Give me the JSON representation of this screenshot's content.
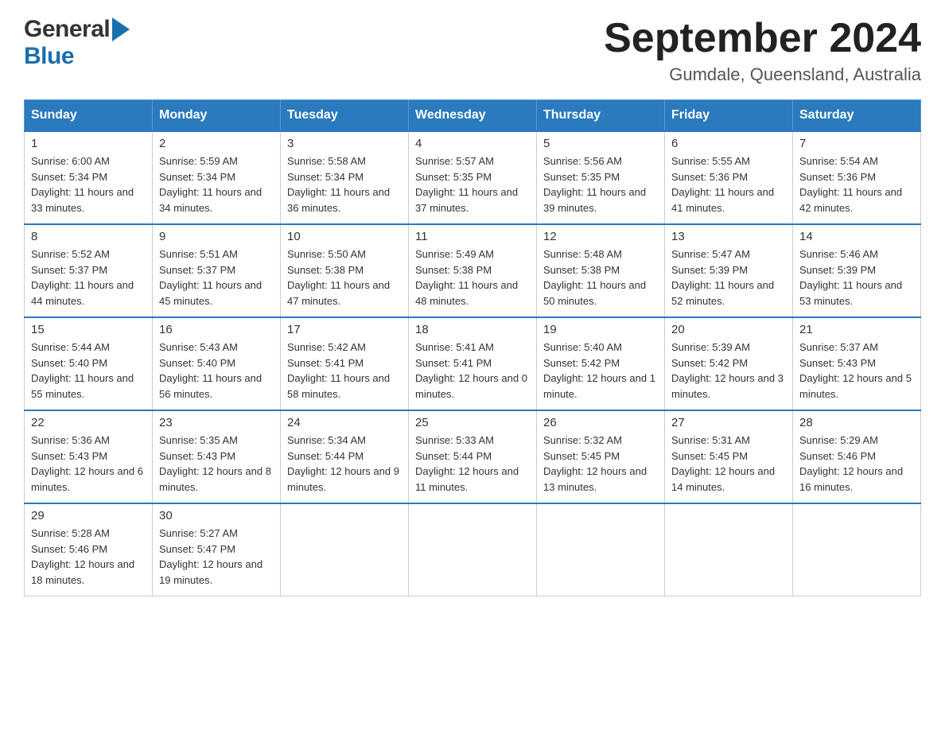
{
  "logo": {
    "general": "General",
    "blue": "Blue"
  },
  "title": "September 2024",
  "location": "Gumdale, Queensland, Australia",
  "headers": [
    "Sunday",
    "Monday",
    "Tuesday",
    "Wednesday",
    "Thursday",
    "Friday",
    "Saturday"
  ],
  "weeks": [
    [
      {
        "day": "1",
        "sunrise": "6:00 AM",
        "sunset": "5:34 PM",
        "daylight": "11 hours and 33 minutes."
      },
      {
        "day": "2",
        "sunrise": "5:59 AM",
        "sunset": "5:34 PM",
        "daylight": "11 hours and 34 minutes."
      },
      {
        "day": "3",
        "sunrise": "5:58 AM",
        "sunset": "5:34 PM",
        "daylight": "11 hours and 36 minutes."
      },
      {
        "day": "4",
        "sunrise": "5:57 AM",
        "sunset": "5:35 PM",
        "daylight": "11 hours and 37 minutes."
      },
      {
        "day": "5",
        "sunrise": "5:56 AM",
        "sunset": "5:35 PM",
        "daylight": "11 hours and 39 minutes."
      },
      {
        "day": "6",
        "sunrise": "5:55 AM",
        "sunset": "5:36 PM",
        "daylight": "11 hours and 41 minutes."
      },
      {
        "day": "7",
        "sunrise": "5:54 AM",
        "sunset": "5:36 PM",
        "daylight": "11 hours and 42 minutes."
      }
    ],
    [
      {
        "day": "8",
        "sunrise": "5:52 AM",
        "sunset": "5:37 PM",
        "daylight": "11 hours and 44 minutes."
      },
      {
        "day": "9",
        "sunrise": "5:51 AM",
        "sunset": "5:37 PM",
        "daylight": "11 hours and 45 minutes."
      },
      {
        "day": "10",
        "sunrise": "5:50 AM",
        "sunset": "5:38 PM",
        "daylight": "11 hours and 47 minutes."
      },
      {
        "day": "11",
        "sunrise": "5:49 AM",
        "sunset": "5:38 PM",
        "daylight": "11 hours and 48 minutes."
      },
      {
        "day": "12",
        "sunrise": "5:48 AM",
        "sunset": "5:38 PM",
        "daylight": "11 hours and 50 minutes."
      },
      {
        "day": "13",
        "sunrise": "5:47 AM",
        "sunset": "5:39 PM",
        "daylight": "11 hours and 52 minutes."
      },
      {
        "day": "14",
        "sunrise": "5:46 AM",
        "sunset": "5:39 PM",
        "daylight": "11 hours and 53 minutes."
      }
    ],
    [
      {
        "day": "15",
        "sunrise": "5:44 AM",
        "sunset": "5:40 PM",
        "daylight": "11 hours and 55 minutes."
      },
      {
        "day": "16",
        "sunrise": "5:43 AM",
        "sunset": "5:40 PM",
        "daylight": "11 hours and 56 minutes."
      },
      {
        "day": "17",
        "sunrise": "5:42 AM",
        "sunset": "5:41 PM",
        "daylight": "11 hours and 58 minutes."
      },
      {
        "day": "18",
        "sunrise": "5:41 AM",
        "sunset": "5:41 PM",
        "daylight": "12 hours and 0 minutes."
      },
      {
        "day": "19",
        "sunrise": "5:40 AM",
        "sunset": "5:42 PM",
        "daylight": "12 hours and 1 minute."
      },
      {
        "day": "20",
        "sunrise": "5:39 AM",
        "sunset": "5:42 PM",
        "daylight": "12 hours and 3 minutes."
      },
      {
        "day": "21",
        "sunrise": "5:37 AM",
        "sunset": "5:43 PM",
        "daylight": "12 hours and 5 minutes."
      }
    ],
    [
      {
        "day": "22",
        "sunrise": "5:36 AM",
        "sunset": "5:43 PM",
        "daylight": "12 hours and 6 minutes."
      },
      {
        "day": "23",
        "sunrise": "5:35 AM",
        "sunset": "5:43 PM",
        "daylight": "12 hours and 8 minutes."
      },
      {
        "day": "24",
        "sunrise": "5:34 AM",
        "sunset": "5:44 PM",
        "daylight": "12 hours and 9 minutes."
      },
      {
        "day": "25",
        "sunrise": "5:33 AM",
        "sunset": "5:44 PM",
        "daylight": "12 hours and 11 minutes."
      },
      {
        "day": "26",
        "sunrise": "5:32 AM",
        "sunset": "5:45 PM",
        "daylight": "12 hours and 13 minutes."
      },
      {
        "day": "27",
        "sunrise": "5:31 AM",
        "sunset": "5:45 PM",
        "daylight": "12 hours and 14 minutes."
      },
      {
        "day": "28",
        "sunrise": "5:29 AM",
        "sunset": "5:46 PM",
        "daylight": "12 hours and 16 minutes."
      }
    ],
    [
      {
        "day": "29",
        "sunrise": "5:28 AM",
        "sunset": "5:46 PM",
        "daylight": "12 hours and 18 minutes."
      },
      {
        "day": "30",
        "sunrise": "5:27 AM",
        "sunset": "5:47 PM",
        "daylight": "12 hours and 19 minutes."
      },
      null,
      null,
      null,
      null,
      null
    ]
  ],
  "labels": {
    "sunrise": "Sunrise:",
    "sunset": "Sunset:",
    "daylight": "Daylight:"
  }
}
